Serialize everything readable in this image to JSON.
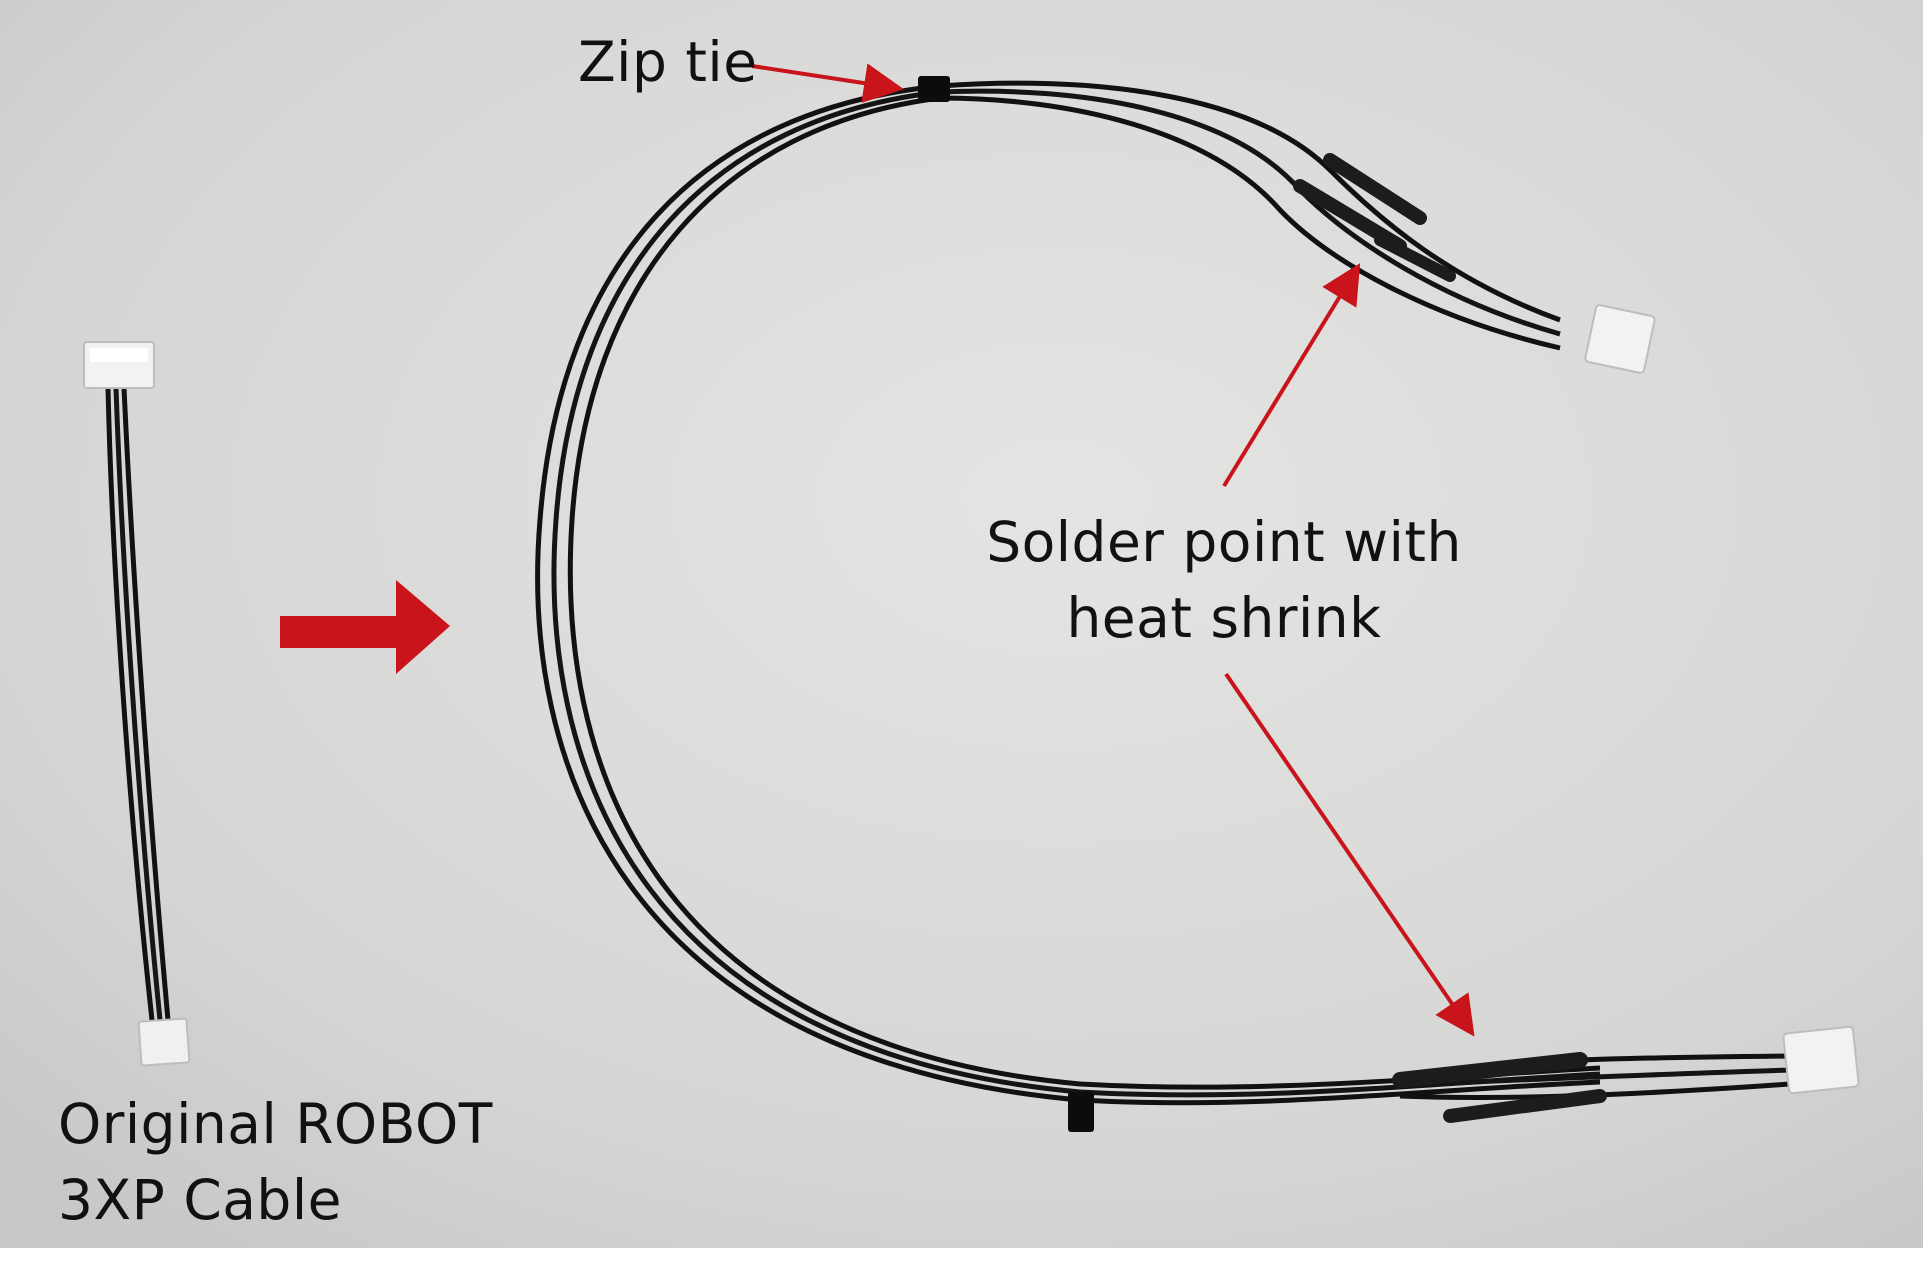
{
  "annotations": {
    "zip_tie": "Zip tie",
    "solder_point_line1": "Solder point with",
    "solder_point_line2": "heat shrink",
    "original_line1": "Original ROBOT",
    "original_line2": "3XP Cable"
  },
  "colors": {
    "background": "#d9d9d7",
    "cable": "#111111",
    "connector": "#f2f2f0",
    "arrow": "#c8141a",
    "text": "#111111"
  },
  "icons": {
    "transform_arrow": "right-arrow-icon"
  }
}
